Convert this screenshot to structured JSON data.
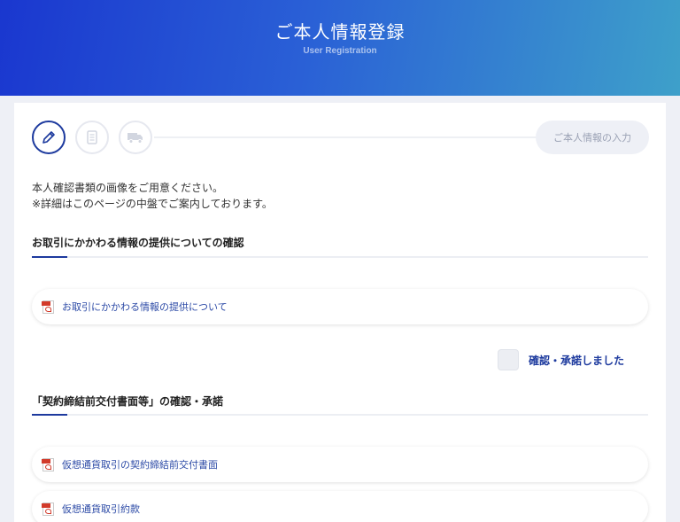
{
  "header": {
    "title": "ご本人情報登録",
    "subtitle": "User Registration"
  },
  "steps": {
    "items": [
      {
        "icon": "pencil-icon",
        "state": "active"
      },
      {
        "icon": "document-icon",
        "state": "inactive"
      },
      {
        "icon": "truck-icon",
        "state": "inactive"
      }
    ],
    "current_label": "ご本人情報の入力"
  },
  "intro": {
    "line1": "本人確認書類の画像をご用意ください。",
    "line2": "※詳細はこのページの中盤でご案内しております。"
  },
  "section1": {
    "title": "お取引にかかわる情報の提供についての確認",
    "links": [
      "お取引にかかわる情報の提供について"
    ],
    "confirm_label": "確認・承諾しました"
  },
  "section2": {
    "title": "「契約締結前交付書面等」の確認・承諾",
    "links": [
      "仮想通貨取引の契約締結前交付書面",
      "仮想通貨取引約款"
    ]
  },
  "colors": {
    "accent": "#1d3a9e",
    "link": "#2c4aa6",
    "pdf_red": "#d23a2a"
  }
}
